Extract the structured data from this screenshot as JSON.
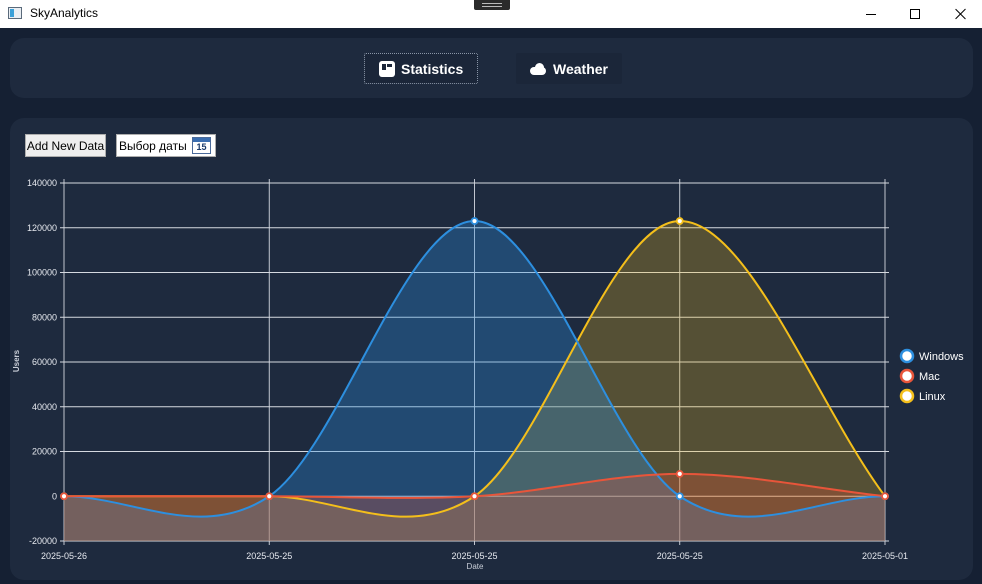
{
  "window": {
    "title": "SkyAnalytics"
  },
  "nav": {
    "statistics_label": "Statistics",
    "weather_label": "Weather"
  },
  "toolbar": {
    "add_label": "Add New Data",
    "date_placeholder": "Выбор даты",
    "calendar_day": "15"
  },
  "colors": {
    "windows": "#2d8fdf",
    "mac": "#e8553a",
    "linux": "#f4bf1b"
  },
  "chart_data": {
    "type": "area",
    "x": [
      "2025-05-26",
      "2025-05-25",
      "2025-05-25",
      "2025-05-25",
      "2025-05-01"
    ],
    "xlabel": "Date",
    "ylabel": "Users",
    "ylim": [
      -20000,
      140000
    ],
    "yticks": [
      -20000,
      0,
      20000,
      40000,
      60000,
      80000,
      100000,
      120000,
      140000
    ],
    "grid": true,
    "legend_position": "right",
    "series": [
      {
        "name": "Windows",
        "values": [
          0,
          0,
          123000,
          0,
          0
        ]
      },
      {
        "name": "Mac",
        "values": [
          0,
          0,
          0,
          10000,
          0
        ]
      },
      {
        "name": "Linux",
        "values": [
          0,
          0,
          0,
          123000,
          0
        ]
      }
    ]
  }
}
